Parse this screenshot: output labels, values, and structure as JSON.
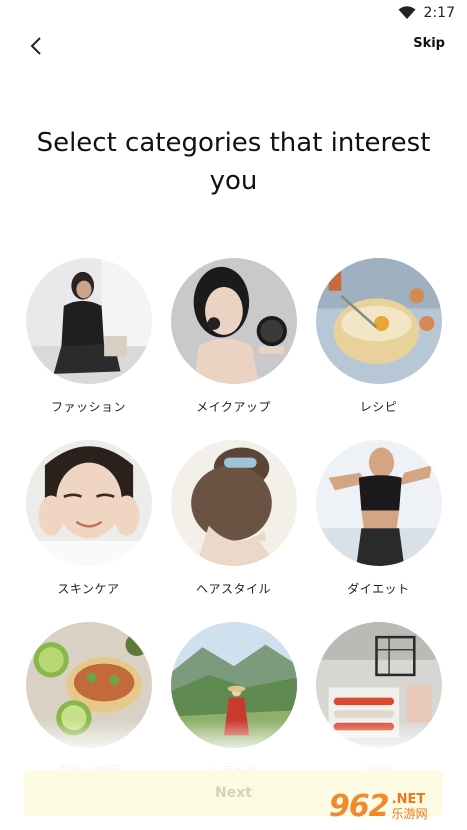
{
  "status_bar": {
    "time": "2:17"
  },
  "header": {
    "skip_label": "Skip"
  },
  "title": "Select categories that interest you",
  "categories": [
    {
      "label": "ファッション",
      "icon": "fashion-photo"
    },
    {
      "label": "メイクアップ",
      "icon": "makeup-photo"
    },
    {
      "label": "レシピ",
      "icon": "recipe-photo"
    },
    {
      "label": "スキンケア",
      "icon": "skincare-photo"
    },
    {
      "label": "ヘアスタイル",
      "icon": "hairstyle-photo"
    },
    {
      "label": "ダイエット",
      "icon": "diet-photo"
    },
    {
      "label": "グルメ旅行",
      "icon": "gourmet-photo"
    },
    {
      "label": "トラベル",
      "icon": "travel-photo"
    },
    {
      "label": "収納",
      "icon": "storage-photo"
    }
  ],
  "footer": {
    "next_label": "Next"
  },
  "watermark": {
    "logo": "962",
    "net": ".NET",
    "cn": "乐游网"
  },
  "colors": {
    "next_bg": "#fdfbe3",
    "next_text": "#d8d4b0",
    "watermark": "#f08a2a"
  }
}
